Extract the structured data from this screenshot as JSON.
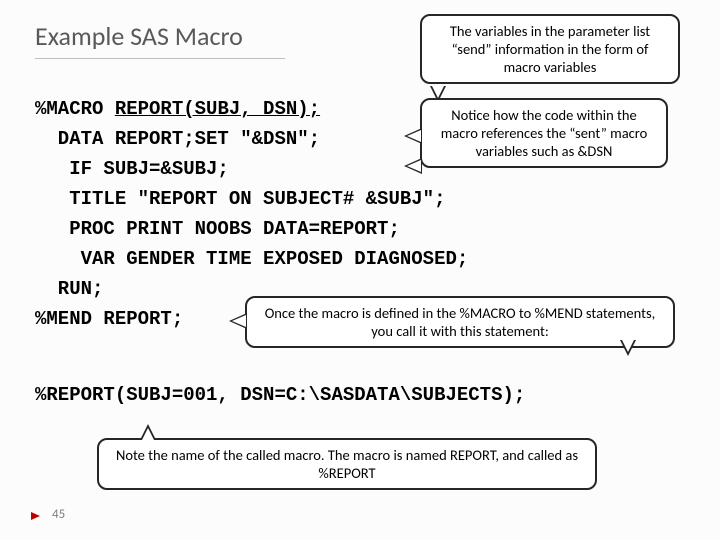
{
  "title": "Example SAS Macro",
  "code": {
    "l1": "%MACRO ",
    "l1b": "REPORT(SUBJ, DSN);",
    "l2": "  DATA REPORT;SET \"&DSN\";",
    "l3": "   IF SUBJ=&SUBJ;",
    "l4": "   TITLE \"REPORT ON SUBJECT# &SUBJ\";",
    "l5": "   PROC PRINT NOOBS DATA=REPORT;",
    "l6": "    VAR GENDER TIME EXPOSED DIAGNOSED;",
    "l7": "  RUN;",
    "l8": "%MEND REPORT;",
    "l9": "%REPORT(SUBJ=001, DSN=C:\\SASDATA\\SUBJECTS);"
  },
  "callouts": {
    "c1": "The variables in the parameter list “send” information in the form of macro variables",
    "c2": "Notice how the code within the macro references the “sent” macro variables such as &DSN",
    "c3": "Once the macro is defined in the %MACRO to %MEND statements, you call it with this statement:",
    "c4": "Note the name of the called macro. The macro is named REPORT, and called as %REPORT"
  },
  "page": "45"
}
